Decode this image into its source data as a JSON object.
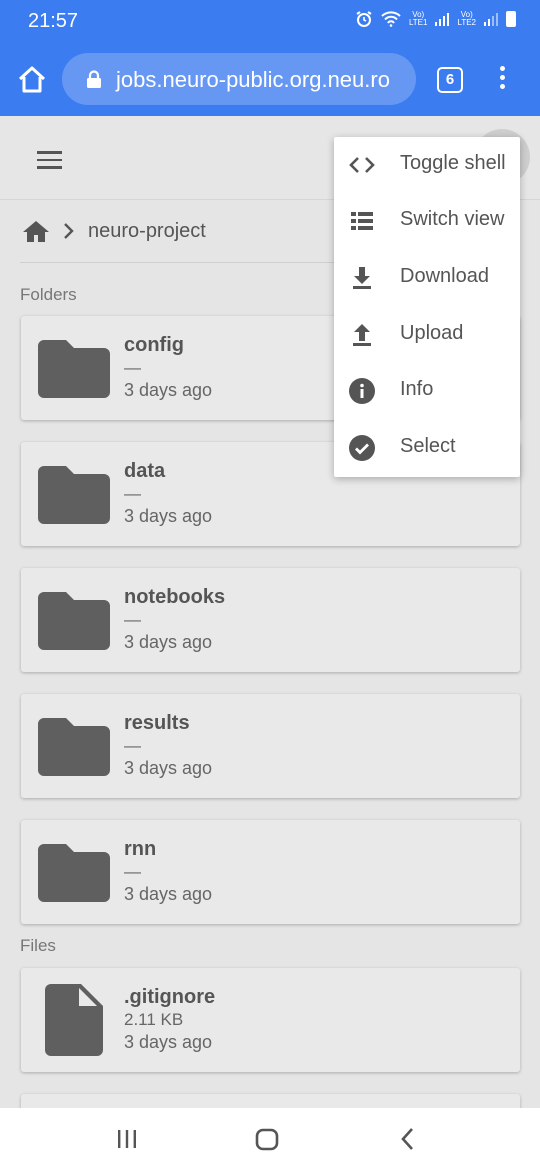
{
  "status_bar": {
    "time": "21:57",
    "sim1": "LTE1",
    "sim2": "LTE2",
    "icons": [
      "alarm-icon",
      "wifi-icon",
      "signal-icon",
      "battery-icon"
    ]
  },
  "browser": {
    "url": "jobs.neuro-public.org.neu.ro",
    "tab_count": "6",
    "accent_color": "#3b7cf0"
  },
  "breadcrumb": {
    "items": [
      "neuro-project"
    ]
  },
  "sections": {
    "folders_label": "Folders",
    "files_label": "Files"
  },
  "folders": [
    {
      "name": "config",
      "meta": "—",
      "date": "3 days ago"
    },
    {
      "name": "data",
      "meta": "—",
      "date": "3 days ago"
    },
    {
      "name": "notebooks",
      "meta": "—",
      "date": "3 days ago"
    },
    {
      "name": "results",
      "meta": "—",
      "date": "3 days ago"
    },
    {
      "name": "rnn",
      "meta": "—",
      "date": "3 days ago"
    }
  ],
  "files": [
    {
      "name": ".gitignore",
      "size": "2.11 KB",
      "date": "3 days ago"
    }
  ],
  "menu": {
    "items": [
      {
        "label": "Toggle shell",
        "icon": "code-icon"
      },
      {
        "label": "Switch view",
        "icon": "list-view-icon"
      },
      {
        "label": "Download",
        "icon": "download-icon"
      },
      {
        "label": "Upload",
        "icon": "upload-icon"
      },
      {
        "label": "Info",
        "icon": "info-icon"
      },
      {
        "label": "Select",
        "icon": "check-circle-icon"
      }
    ]
  }
}
